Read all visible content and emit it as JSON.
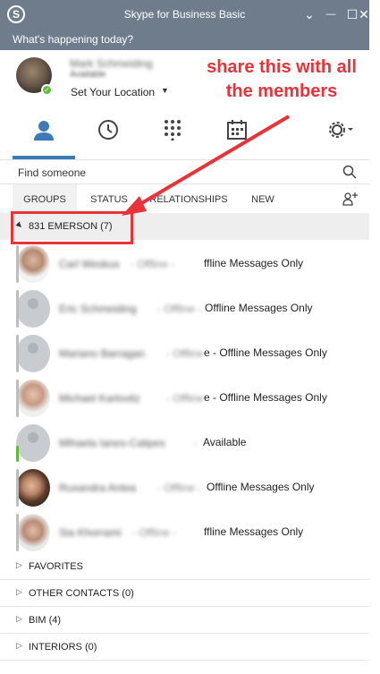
{
  "window": {
    "title": "Skype for Business Basic",
    "logo": "S",
    "controls": {
      "menu": "⌄",
      "minimize": "—",
      "maximize": "☐",
      "close": "✕"
    }
  },
  "whats_happening": "What's happening today?",
  "profile": {
    "name": "Mark Schmeiding",
    "status_text": "Available",
    "location": "Set Your Location",
    "presence_color": "#5dba3b"
  },
  "annotation": {
    "text": "share this with all the members",
    "color": "#e8333a"
  },
  "iconbar": {
    "accent": "#3d7ab8",
    "items": [
      "contacts-icon",
      "history-icon",
      "dialpad-icon",
      "meetings-icon",
      "options-gear-icon"
    ]
  },
  "search": {
    "placeholder": "Find someone"
  },
  "tabs": [
    "GROUPS",
    "STATUS",
    "RELATIONSHIPS",
    "NEW"
  ],
  "expanded_group": {
    "label": "831 EMERSON (7)"
  },
  "contacts": [
    {
      "name": "Carl Weskus",
      "sep": "- Offline -",
      "status": "ffline Messages Only",
      "presence": "#bdbdbd"
    },
    {
      "name": "Eric Schmeiding",
      "sep": "- Offline -",
      "status": "Offline Messages Only",
      "presence": "#bdbdbd"
    },
    {
      "name": "Mariano Barragan",
      "sep": "- Offline",
      "status": "e - Offline Messages Only",
      "presence": "#bdbdbd"
    },
    {
      "name": "Michael Karlovitz",
      "sep": "- Offline",
      "status": "e - Offline Messages Only",
      "presence": "#bdbdbd"
    },
    {
      "name": "Mihaela Ianes-Calipes",
      "sep": "-",
      "status": "Available",
      "presence": "#5dba3b"
    },
    {
      "name": "Ruxandra Antea",
      "sep": "- Offline -",
      "status": "Offline Messages Only",
      "presence": "#bdbdbd"
    },
    {
      "name": "Sia Khorrami",
      "sep": "- Offline -",
      "status": "ffline Messages Only",
      "presence": "#bdbdbd"
    }
  ],
  "groups": [
    {
      "label": "FAVORITES"
    },
    {
      "label": "OTHER CONTACTS (0)"
    },
    {
      "label": "BIM (4)"
    },
    {
      "label": "INTERIORS (0)"
    }
  ]
}
